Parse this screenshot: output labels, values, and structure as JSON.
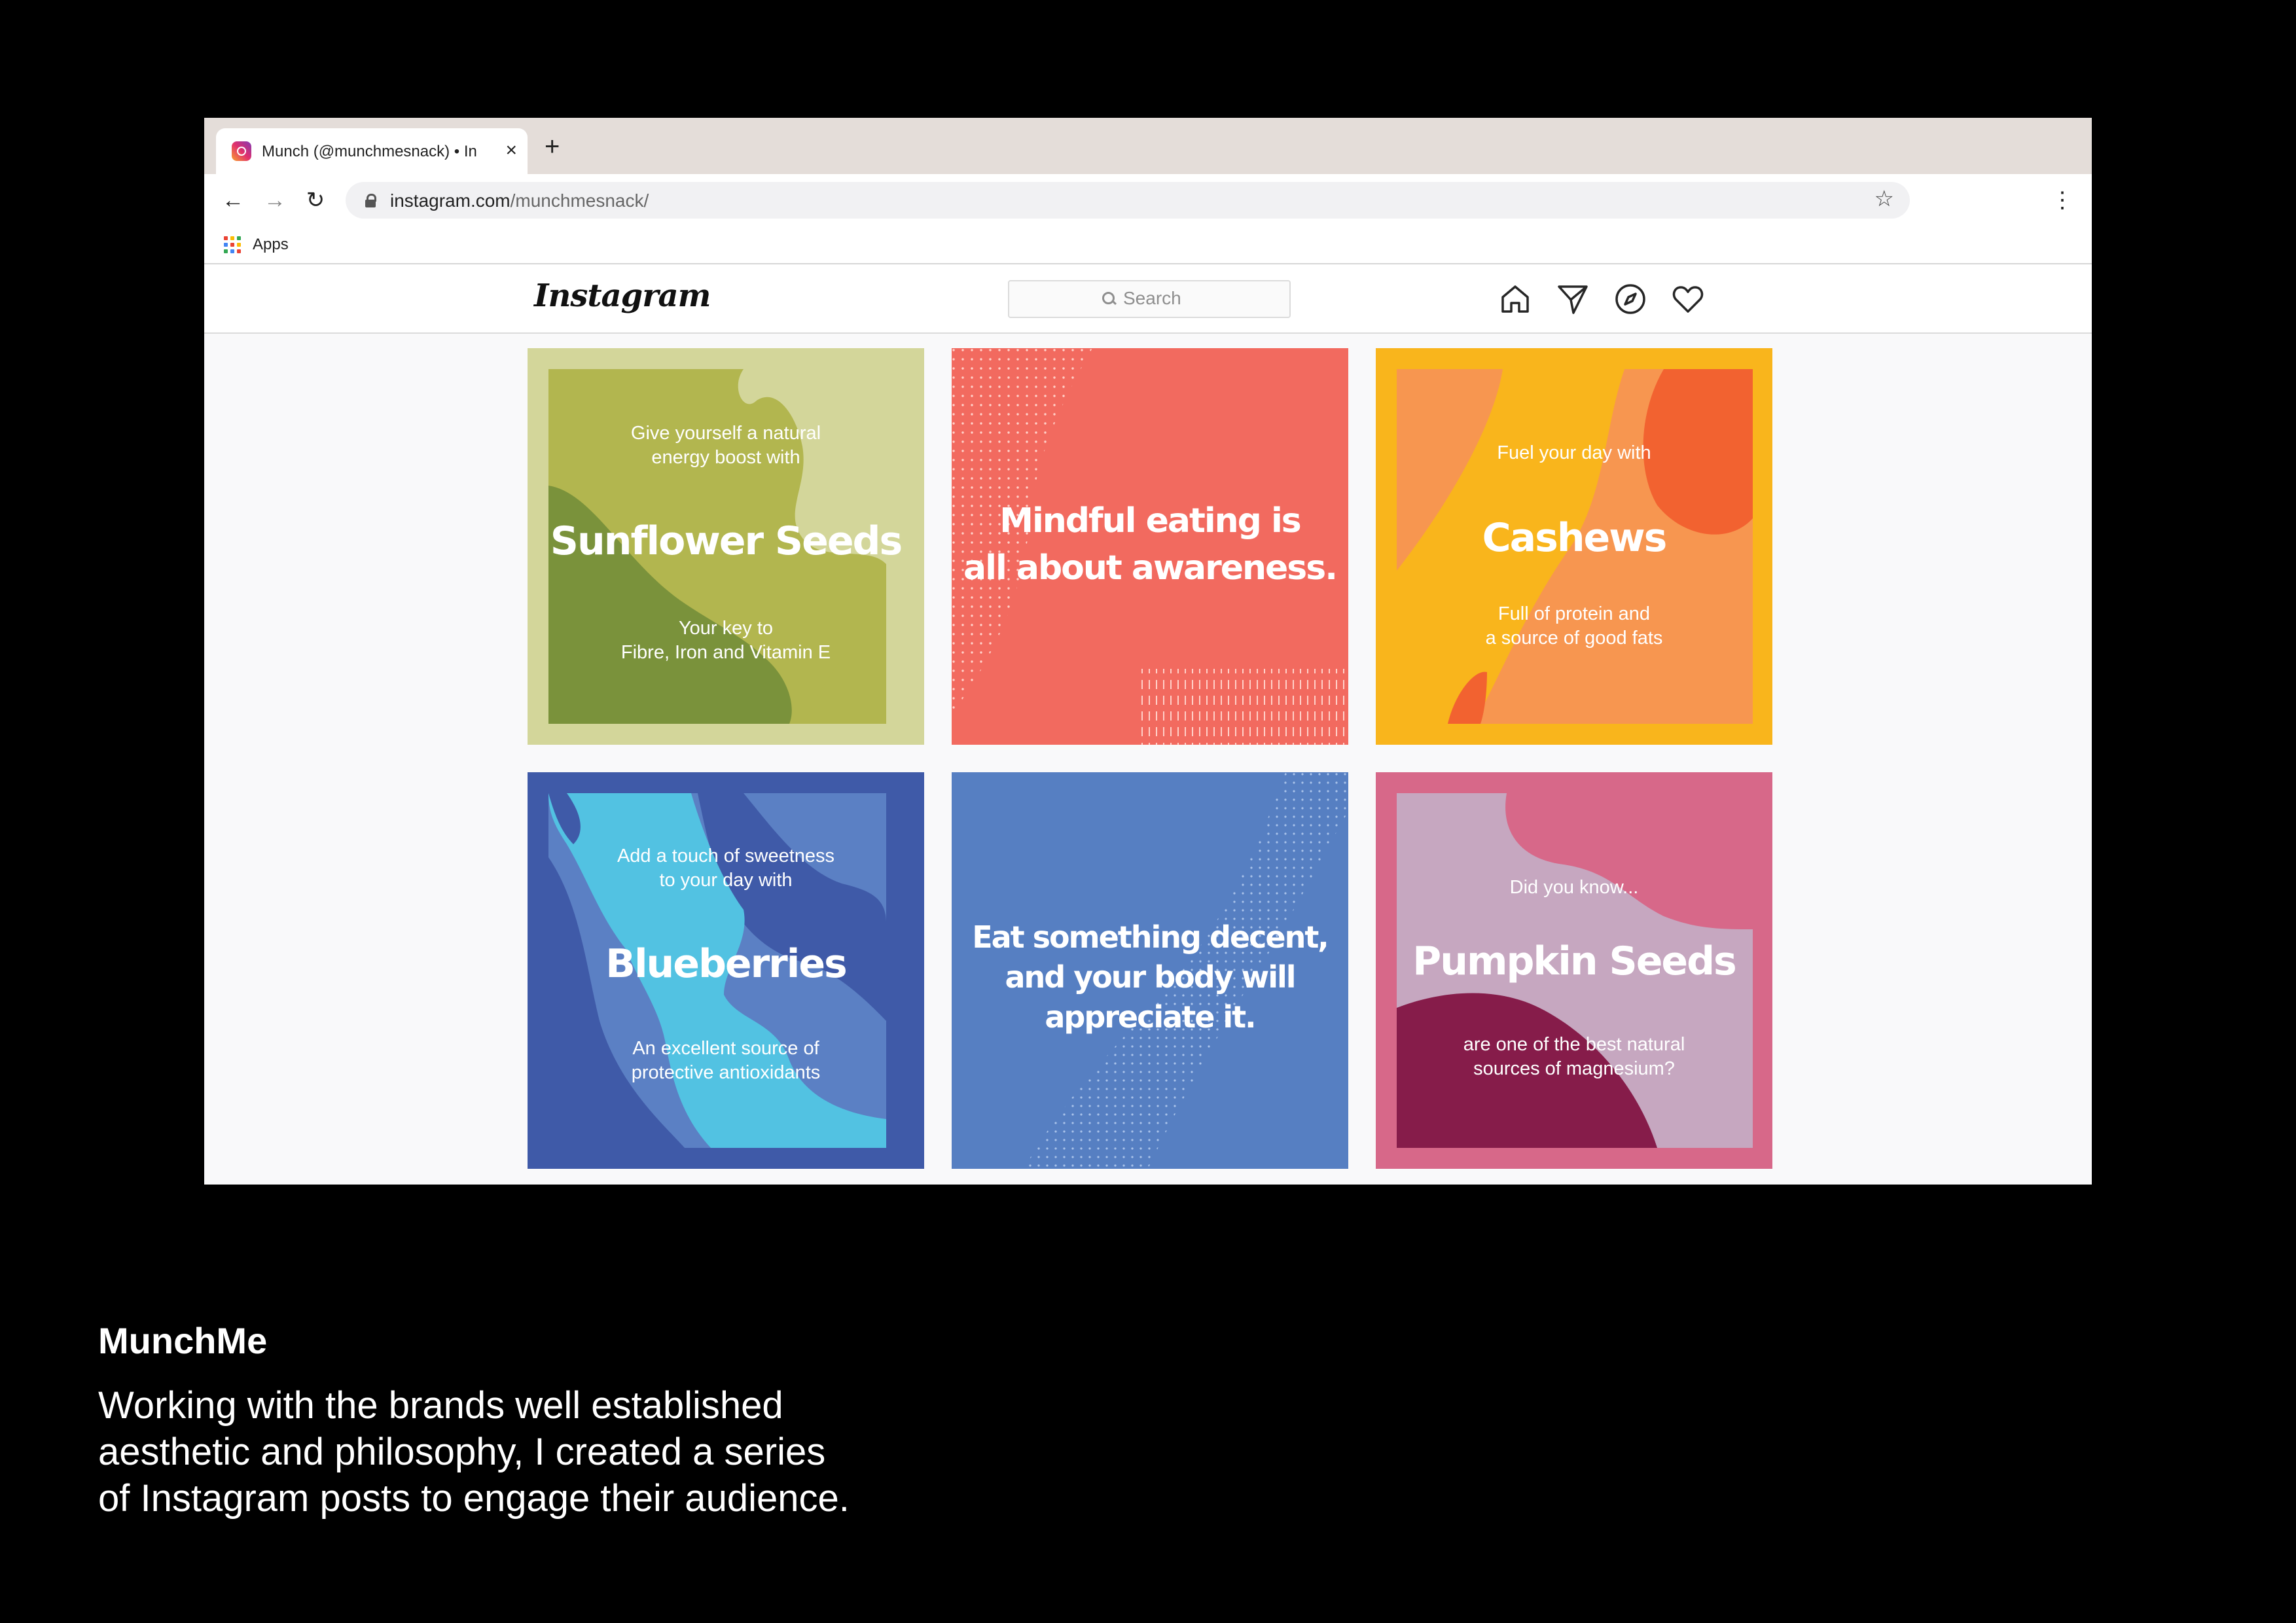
{
  "browser": {
    "tab_title": "Munch (@munchmesnack) • In",
    "tab_close": "×",
    "new_tab": "+",
    "url_domain": "instagram.com",
    "url_path": "/munchmesnack/",
    "bookmarks_apps": "Apps"
  },
  "instagram": {
    "logo": "Instagram",
    "search_placeholder": "Search",
    "nav_icons": [
      "home-icon",
      "direct-icon",
      "explore-icon",
      "activity-icon"
    ]
  },
  "posts": [
    {
      "top": "Give yourself a natural\nenergy boost with",
      "title": "Sunflower Seeds",
      "bottom": "Your key to\nFibre, Iron and Vitamin E"
    },
    {
      "quote": "Mindful eating is\nall about awareness."
    },
    {
      "top": "Fuel your day with",
      "title": "Cashews",
      "bottom": "Full of protein and\na source of good fats"
    },
    {
      "top": "Add a touch of sweetness\nto your day with",
      "title": "Blueberries",
      "bottom": "An excellent source of\nprotective antioxidants"
    },
    {
      "quote": "Eat something decent,\nand your body will\nappreciate it."
    },
    {
      "top": "Did you know...",
      "title": "Pumpkin Seeds",
      "bottom": "are one of the best natural\nsources of magnesium?"
    }
  ],
  "colors": {
    "sunflower": "#d3d69a",
    "mindful": "#f26a5f",
    "cashews": "#f9b51c",
    "blueberries": "#3f5aa8",
    "eat": "#567fc2",
    "pumpkin": "#d76889"
  },
  "caption": {
    "title": "MunchMe",
    "body": "Working with the brands well established\naesthetic and philosophy, I created a series\nof Instagram posts to engage their audience."
  }
}
